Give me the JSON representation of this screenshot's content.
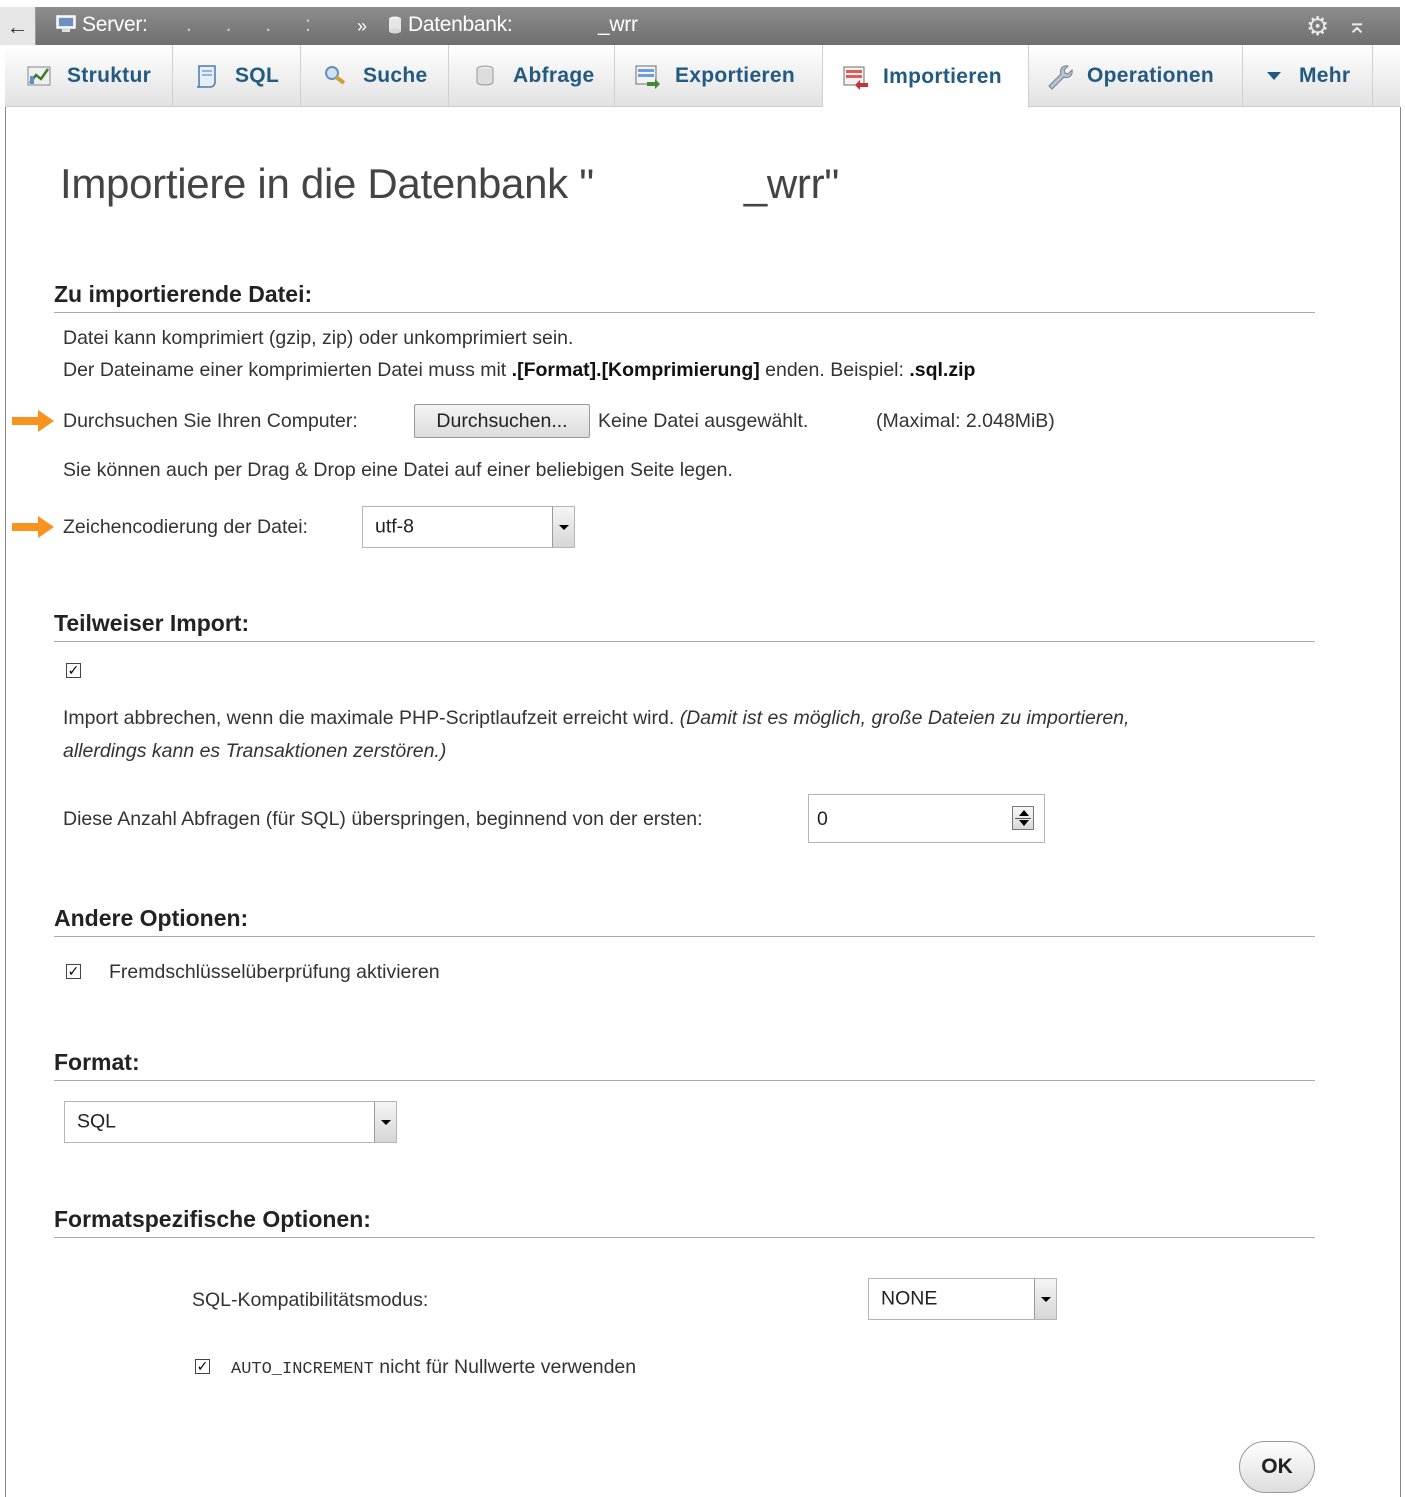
{
  "breadcrumb": {
    "server_label": "Server:",
    "server_name_mask": ". . . :",
    "separator": "»",
    "database_label": "Datenbank:",
    "database_name": "_wrr"
  },
  "tabs": [
    {
      "label": "Struktur",
      "icon": "structure-icon"
    },
    {
      "label": "SQL",
      "icon": "sql-icon"
    },
    {
      "label": "Suche",
      "icon": "search-icon"
    },
    {
      "label": "Abfrage",
      "icon": "query-icon"
    },
    {
      "label": "Exportieren",
      "icon": "export-icon"
    },
    {
      "label": "Importieren",
      "icon": "import-icon",
      "active": true
    },
    {
      "label": "Operationen",
      "icon": "wrench-icon"
    },
    {
      "label": "Mehr",
      "icon": "caret-down-icon"
    }
  ],
  "page": {
    "title_prefix": "Importiere in die Datenbank \"",
    "title_db": "_wrr",
    "title_suffix": "\""
  },
  "file_section": {
    "heading": "Zu importierende Datei:",
    "line1": "Datei kann komprimiert (gzip, zip) oder unkomprimiert sein.",
    "line2_part1": "Der Dateiname einer komprimierten Datei muss mit ",
    "line2_bold1": ".[Format].[Komprimierung]",
    "line2_part2": " enden. Beispiel: ",
    "line2_bold2": ".sql.zip",
    "browse_label": "Durchsuchen Sie Ihren Computer:",
    "browse_button": "Durchsuchen...",
    "no_file": "Keine Datei ausgewählt.",
    "max_size": "(Maximal: 2.048MiB)",
    "drag_drop": "Sie können auch per Drag & Drop eine Datei auf einer beliebigen Seite legen.",
    "charset_label": "Zeichencodierung der Datei:",
    "charset_value": "utf-8"
  },
  "partial_section": {
    "heading": "Teilweiser Import:",
    "checked": true,
    "text_normal": "Import abbrechen, wenn die maximale PHP-Scriptlaufzeit erreicht wird.",
    "text_italic1": "(Damit ist es möglich, große Dateien zu importieren,",
    "text_italic2": "allerdings kann es Transaktionen zerstören.)",
    "skip_label": "Diese Anzahl Abfragen (für SQL) überspringen, beginnend von der ersten:",
    "skip_value": "0"
  },
  "other_section": {
    "heading": "Andere Optionen:",
    "fk_checked": true,
    "fk_label": "Fremdschlüsselüberprüfung aktivieren"
  },
  "format_section": {
    "heading": "Format:",
    "value": "SQL"
  },
  "format_options": {
    "heading": "Formatspezifische Optionen:",
    "compat_label": "SQL-Kompatibilitätsmodus:",
    "compat_value": "NONE",
    "auto_inc_checked": true,
    "auto_inc_code": "AUTO_INCREMENT",
    "auto_inc_text": " nicht für Nullwerte verwenden"
  },
  "ok_button": "OK",
  "colors": {
    "tab_text": "#235a81",
    "arrow": "#f7931e",
    "topbar": "#7d7d7d"
  }
}
